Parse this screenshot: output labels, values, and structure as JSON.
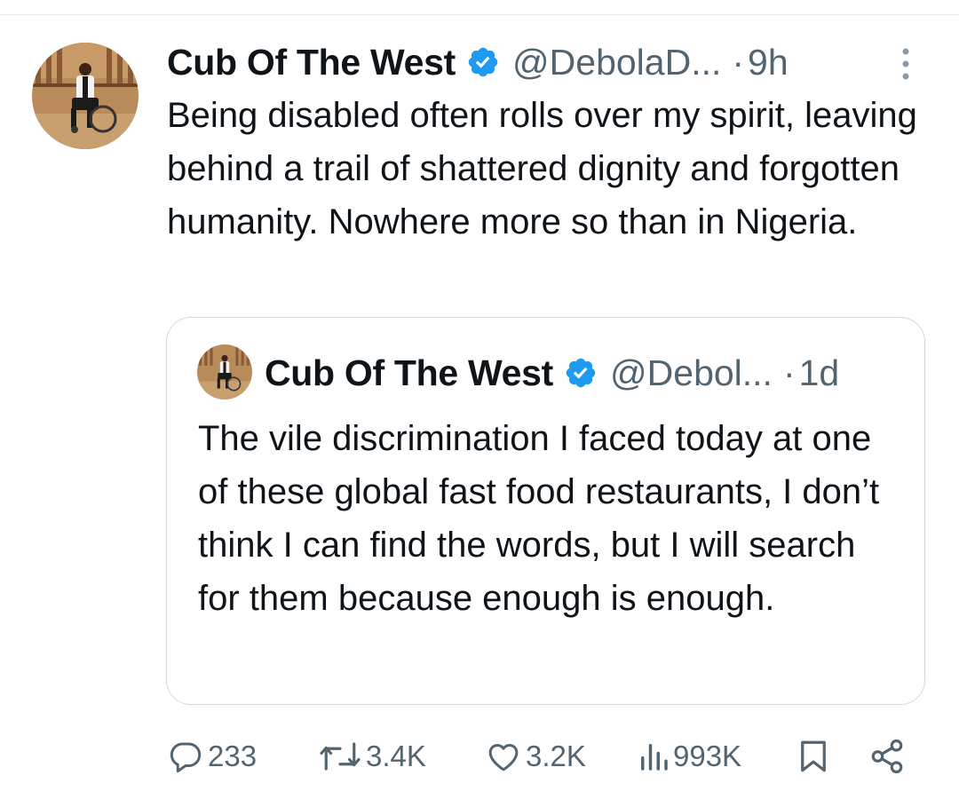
{
  "tweet": {
    "author_name": "Cub Of The West",
    "handle": "@DebolaD...",
    "separator": "·",
    "time": "9h",
    "text": "Being disabled often rolls over my spirit, leaving behind a trail of shattered dignity and forgotten humanity. Nowhere more so than in Nigeria."
  },
  "quoted": {
    "author_name": "Cub Of The West",
    "handle": "@Debol...",
    "separator": "·",
    "time": "1d",
    "text": "The vile discrimination I faced today at one of these global fast food restaurants, I don’t think I can find the words, but I will search for them because enough is enough."
  },
  "actions": {
    "replies": "233",
    "reposts": "3.4K",
    "likes": "3.2K",
    "views": "993K"
  },
  "colors": {
    "verified": "#1d9bf0",
    "text": "#0f1419",
    "muted": "#536471",
    "border": "#cfd9de"
  },
  "icons": [
    "more-vertical-icon",
    "verified-badge-icon",
    "reply-icon",
    "repost-icon",
    "like-icon",
    "views-icon",
    "bookmark-icon",
    "share-icon"
  ]
}
